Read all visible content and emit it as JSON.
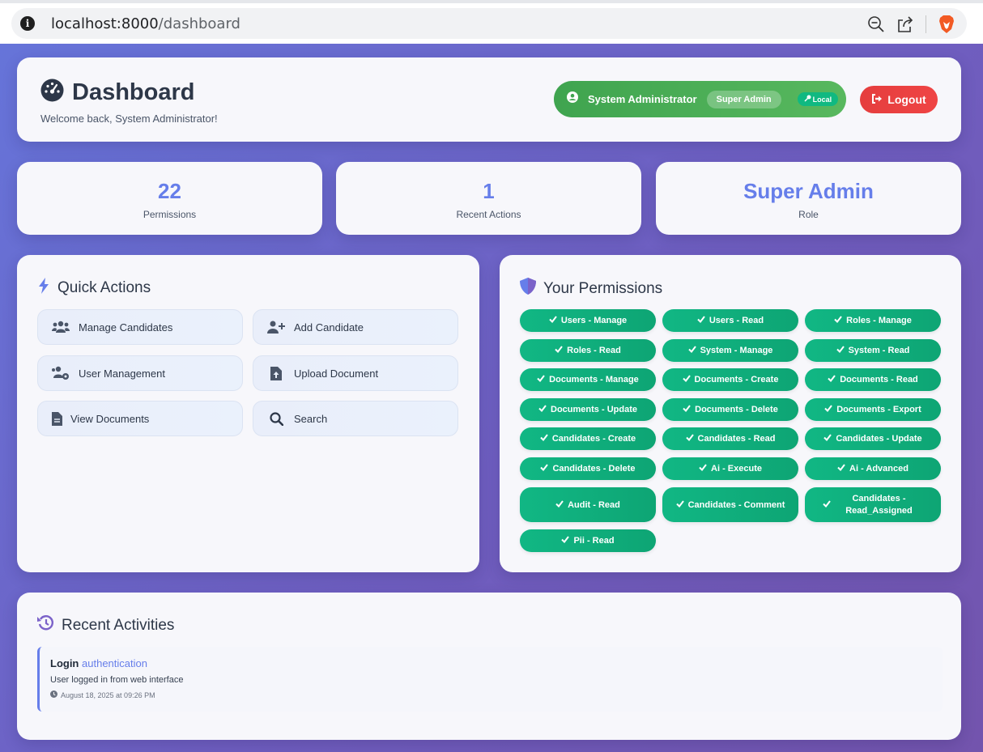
{
  "browser": {
    "url_host": "localhost:8000",
    "url_path": "/dashboard",
    "info_icon": "i"
  },
  "header": {
    "title": "Dashboard",
    "welcome": "Welcome back, System Administrator!",
    "user_name": "System Administrator",
    "role_badge": "Super Admin",
    "auth_badge": "Local",
    "logout_label": "Logout"
  },
  "stats": [
    {
      "value": "22",
      "label": "Permissions"
    },
    {
      "value": "1",
      "label": "Recent Actions"
    },
    {
      "value": "Super Admin",
      "label": "Role"
    }
  ],
  "quick_actions": {
    "title": "Quick Actions",
    "items": [
      {
        "label": "Manage Candidates",
        "icon": "users-icon"
      },
      {
        "label": "Add Candidate",
        "icon": "user-plus-icon"
      },
      {
        "label": "User Management",
        "icon": "users-cog-icon"
      },
      {
        "label": "Upload Document",
        "icon": "file-upload-icon"
      },
      {
        "label": "View Documents",
        "icon": "file-text-icon"
      },
      {
        "label": "Search",
        "icon": "search-icon"
      }
    ]
  },
  "permissions": {
    "title": "Your Permissions",
    "items": [
      "Users - Manage",
      "Users - Read",
      "Roles - Manage",
      "Roles - Read",
      "System - Manage",
      "System - Read",
      "Documents - Manage",
      "Documents - Create",
      "Documents - Read",
      "Documents - Update",
      "Documents - Delete",
      "Documents - Export",
      "Candidates - Create",
      "Candidates - Read",
      "Candidates - Update",
      "Candidates - Delete",
      "Ai - Execute",
      "Ai - Advanced",
      "Audit - Read",
      "Candidates - Comment",
      "Candidates - Read_Assigned",
      "Pii - Read"
    ]
  },
  "recent": {
    "title": "Recent Activities",
    "items": [
      {
        "action": "Login",
        "type": "authentication",
        "description": "User logged in from web interface",
        "time": "August 18, 2025 at 09:26 PM"
      }
    ]
  },
  "colors": {
    "accent": "#667eea",
    "success": "#10b981",
    "danger": "#e53e3e",
    "user_pill": "#3fa44f"
  }
}
